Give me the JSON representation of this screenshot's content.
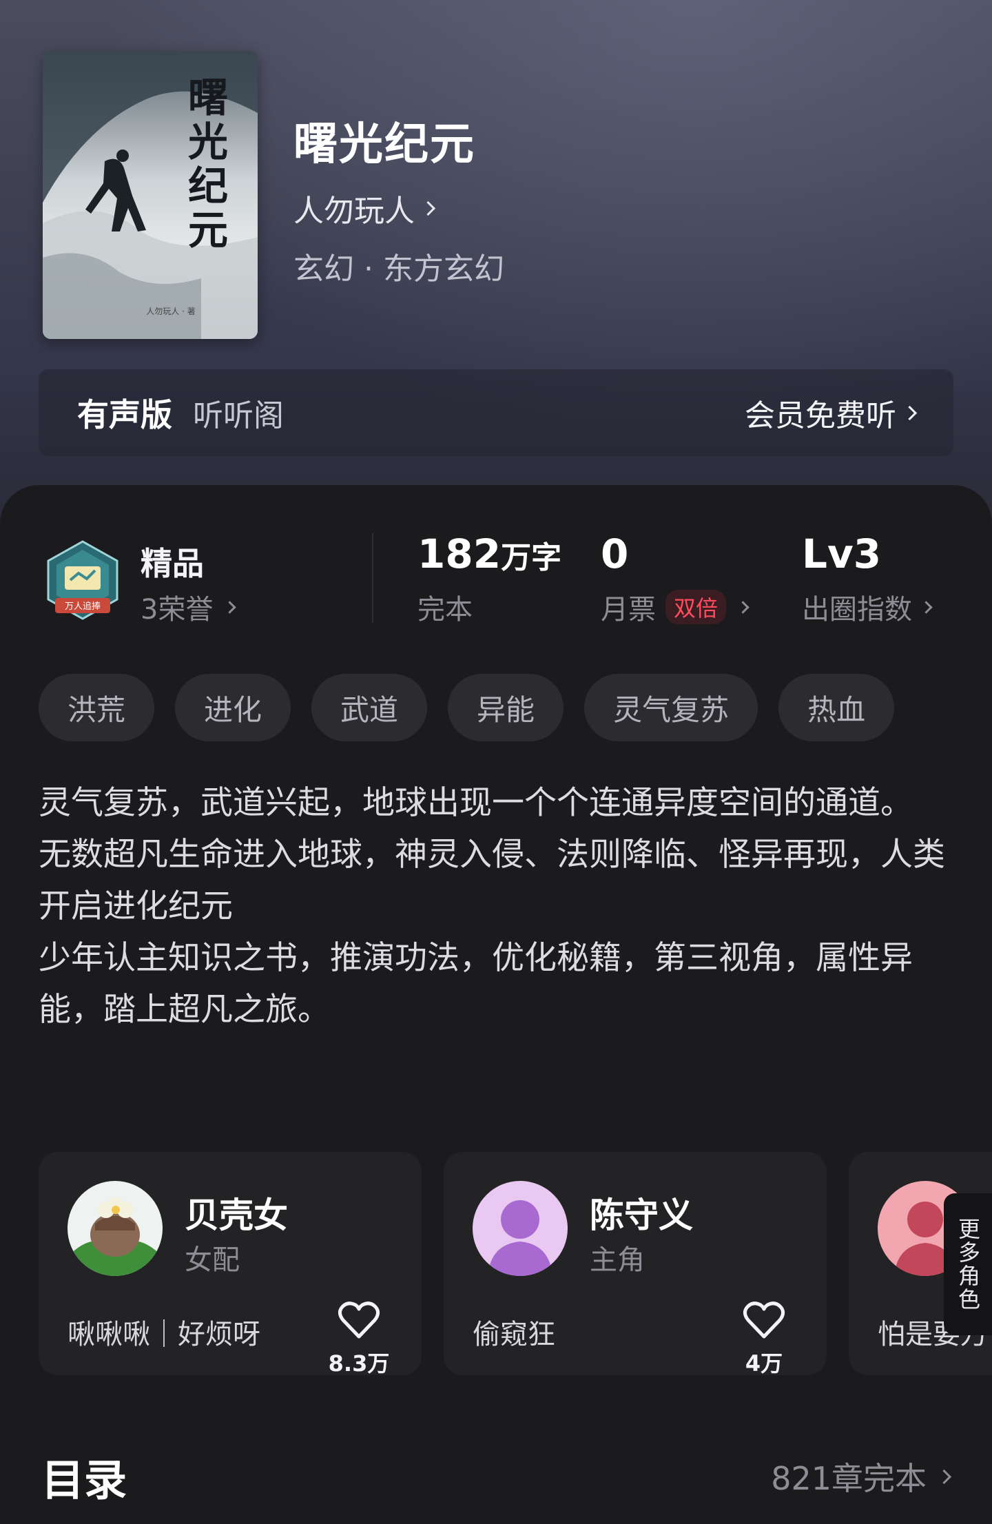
{
  "book": {
    "cover_title": "曙光纪元",
    "cover_author": "人勿玩人 · 著",
    "title": "曙光纪元",
    "author": "人勿玩人",
    "genre": "玄幻 · 东方玄幻"
  },
  "audio": {
    "label": "有声版",
    "source": "听听阁",
    "cta": "会员免费听"
  },
  "stats": {
    "premium_label": "精品",
    "premium_badge_text": "万人追捧",
    "honors": "3荣誉",
    "word_count_num": "182",
    "word_count_unit": "万字",
    "status": "完本",
    "monthly_tickets": "0",
    "monthly_label": "月票",
    "double_badge": "双倍",
    "level": "Lv3",
    "level_label": "出圈指数"
  },
  "tags": [
    "洪荒",
    "进化",
    "武道",
    "异能",
    "灵气复苏",
    "热血"
  ],
  "description": [
    "灵气复苏，武道兴起，地球出现一个个连通异度空间的通道。",
    "无数超凡生命进入地球，神灵入侵、法则降临、怪异再现，人类开启进化纪元",
    "少年认主知识之书，推演功法，优化秘籍，第三视角，属性异能，踏上超凡之旅。"
  ],
  "characters": [
    {
      "name": "贝壳女",
      "role": "女配",
      "quote": "啾啾啾｜好烦呀",
      "likes": "8.3万"
    },
    {
      "name": "陈守义",
      "role": "主角",
      "quote": "偷窥狂",
      "likes": "4万"
    },
    {
      "name": "",
      "role": "",
      "quote": "怕是要万"
    }
  ],
  "more_roles": "更多角色",
  "toc": {
    "title": "目录",
    "meta": "821章完本"
  },
  "colors": {
    "accent_red": "#ff4d5e",
    "background": "#1b1b1d"
  }
}
